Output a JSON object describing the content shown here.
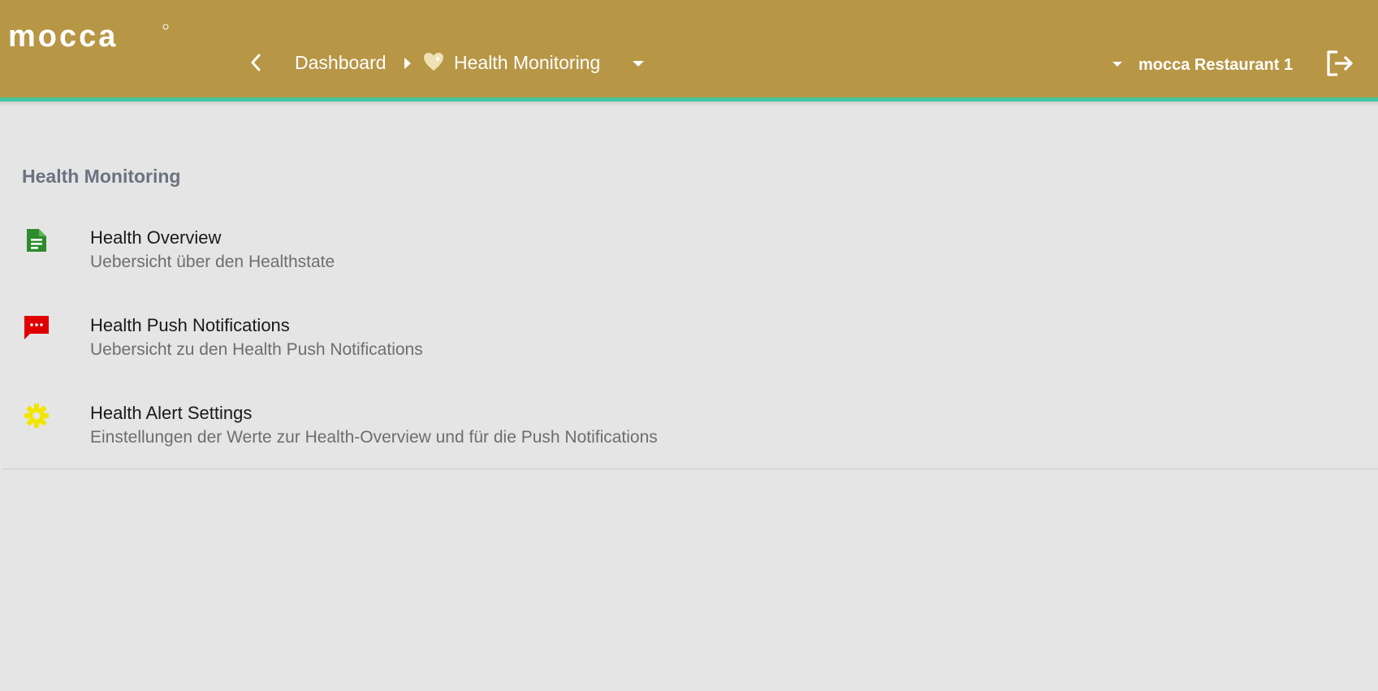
{
  "header": {
    "logo_text": "mocca",
    "breadcrumb": {
      "root_label": "Dashboard",
      "current_label": "Health Monitoring"
    },
    "restaurant_label": "mocca Restaurant 1"
  },
  "colors": {
    "header_bg": "#b79646",
    "header_accent": "#3fc6a0",
    "page_bg": "#e5e5e5",
    "overview_icon": "#2e8b2e",
    "notifications_icon": "#e00000",
    "settings_icon": "#f2e600"
  },
  "icons": {
    "back": "chevron-left-icon",
    "separator": "caret-right-icon",
    "breadcrumb": "heart-icon",
    "dropdown": "caret-down-icon",
    "logout": "logout-icon",
    "overview": "document-icon",
    "notifications": "chat-message-icon",
    "settings": "gear-icon"
  },
  "main": {
    "section_title": "Health Monitoring",
    "items": [
      {
        "title": "Health Overview",
        "subtitle": "Uebersicht über den Healthstate"
      },
      {
        "title": "Health Push Notifications",
        "subtitle": "Uebersicht zu den Health Push Notifications"
      },
      {
        "title": "Health Alert Settings",
        "subtitle": "Einstellungen der Werte zur Health-Overview und für die Push Notifications"
      }
    ]
  }
}
